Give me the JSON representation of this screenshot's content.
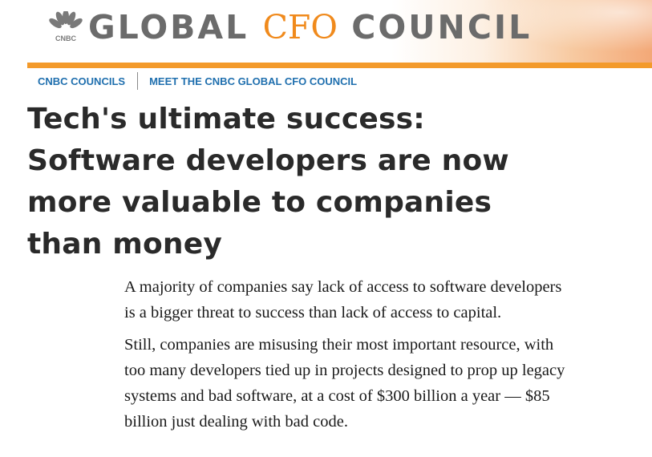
{
  "header": {
    "logo_name": "peacock-icon",
    "brand_lines": {
      "part1": "GLOBAL",
      "part2": "CFO",
      "part3": "COUNCIL"
    },
    "colors": {
      "brand_gray": "#6b6b6b",
      "brand_orange": "#f08a1c",
      "rule": "#f39a2b",
      "link": "#1f6fae"
    }
  },
  "breadcrumbs": [
    {
      "label": "CNBC COUNCILS"
    },
    {
      "label": "MEET THE CNBC GLOBAL CFO COUNCIL"
    }
  ],
  "article": {
    "headline_lines": [
      "Tech's ultimate success:",
      "Software developers are now",
      "more valuable to companies",
      "than money"
    ],
    "bullets": [
      {
        "lines": [
          "A majority of companies say lack of access to software developers",
          "is a bigger threat to success than lack of access to capital."
        ]
      },
      {
        "lines": [
          "Still, companies are misusing their most important resource, with",
          "too many developers tied up in projects designed to prop up legacy",
          "systems and bad software, at a cost of $300 billion a year — $85",
          "billion just dealing with bad code."
        ]
      }
    ]
  }
}
